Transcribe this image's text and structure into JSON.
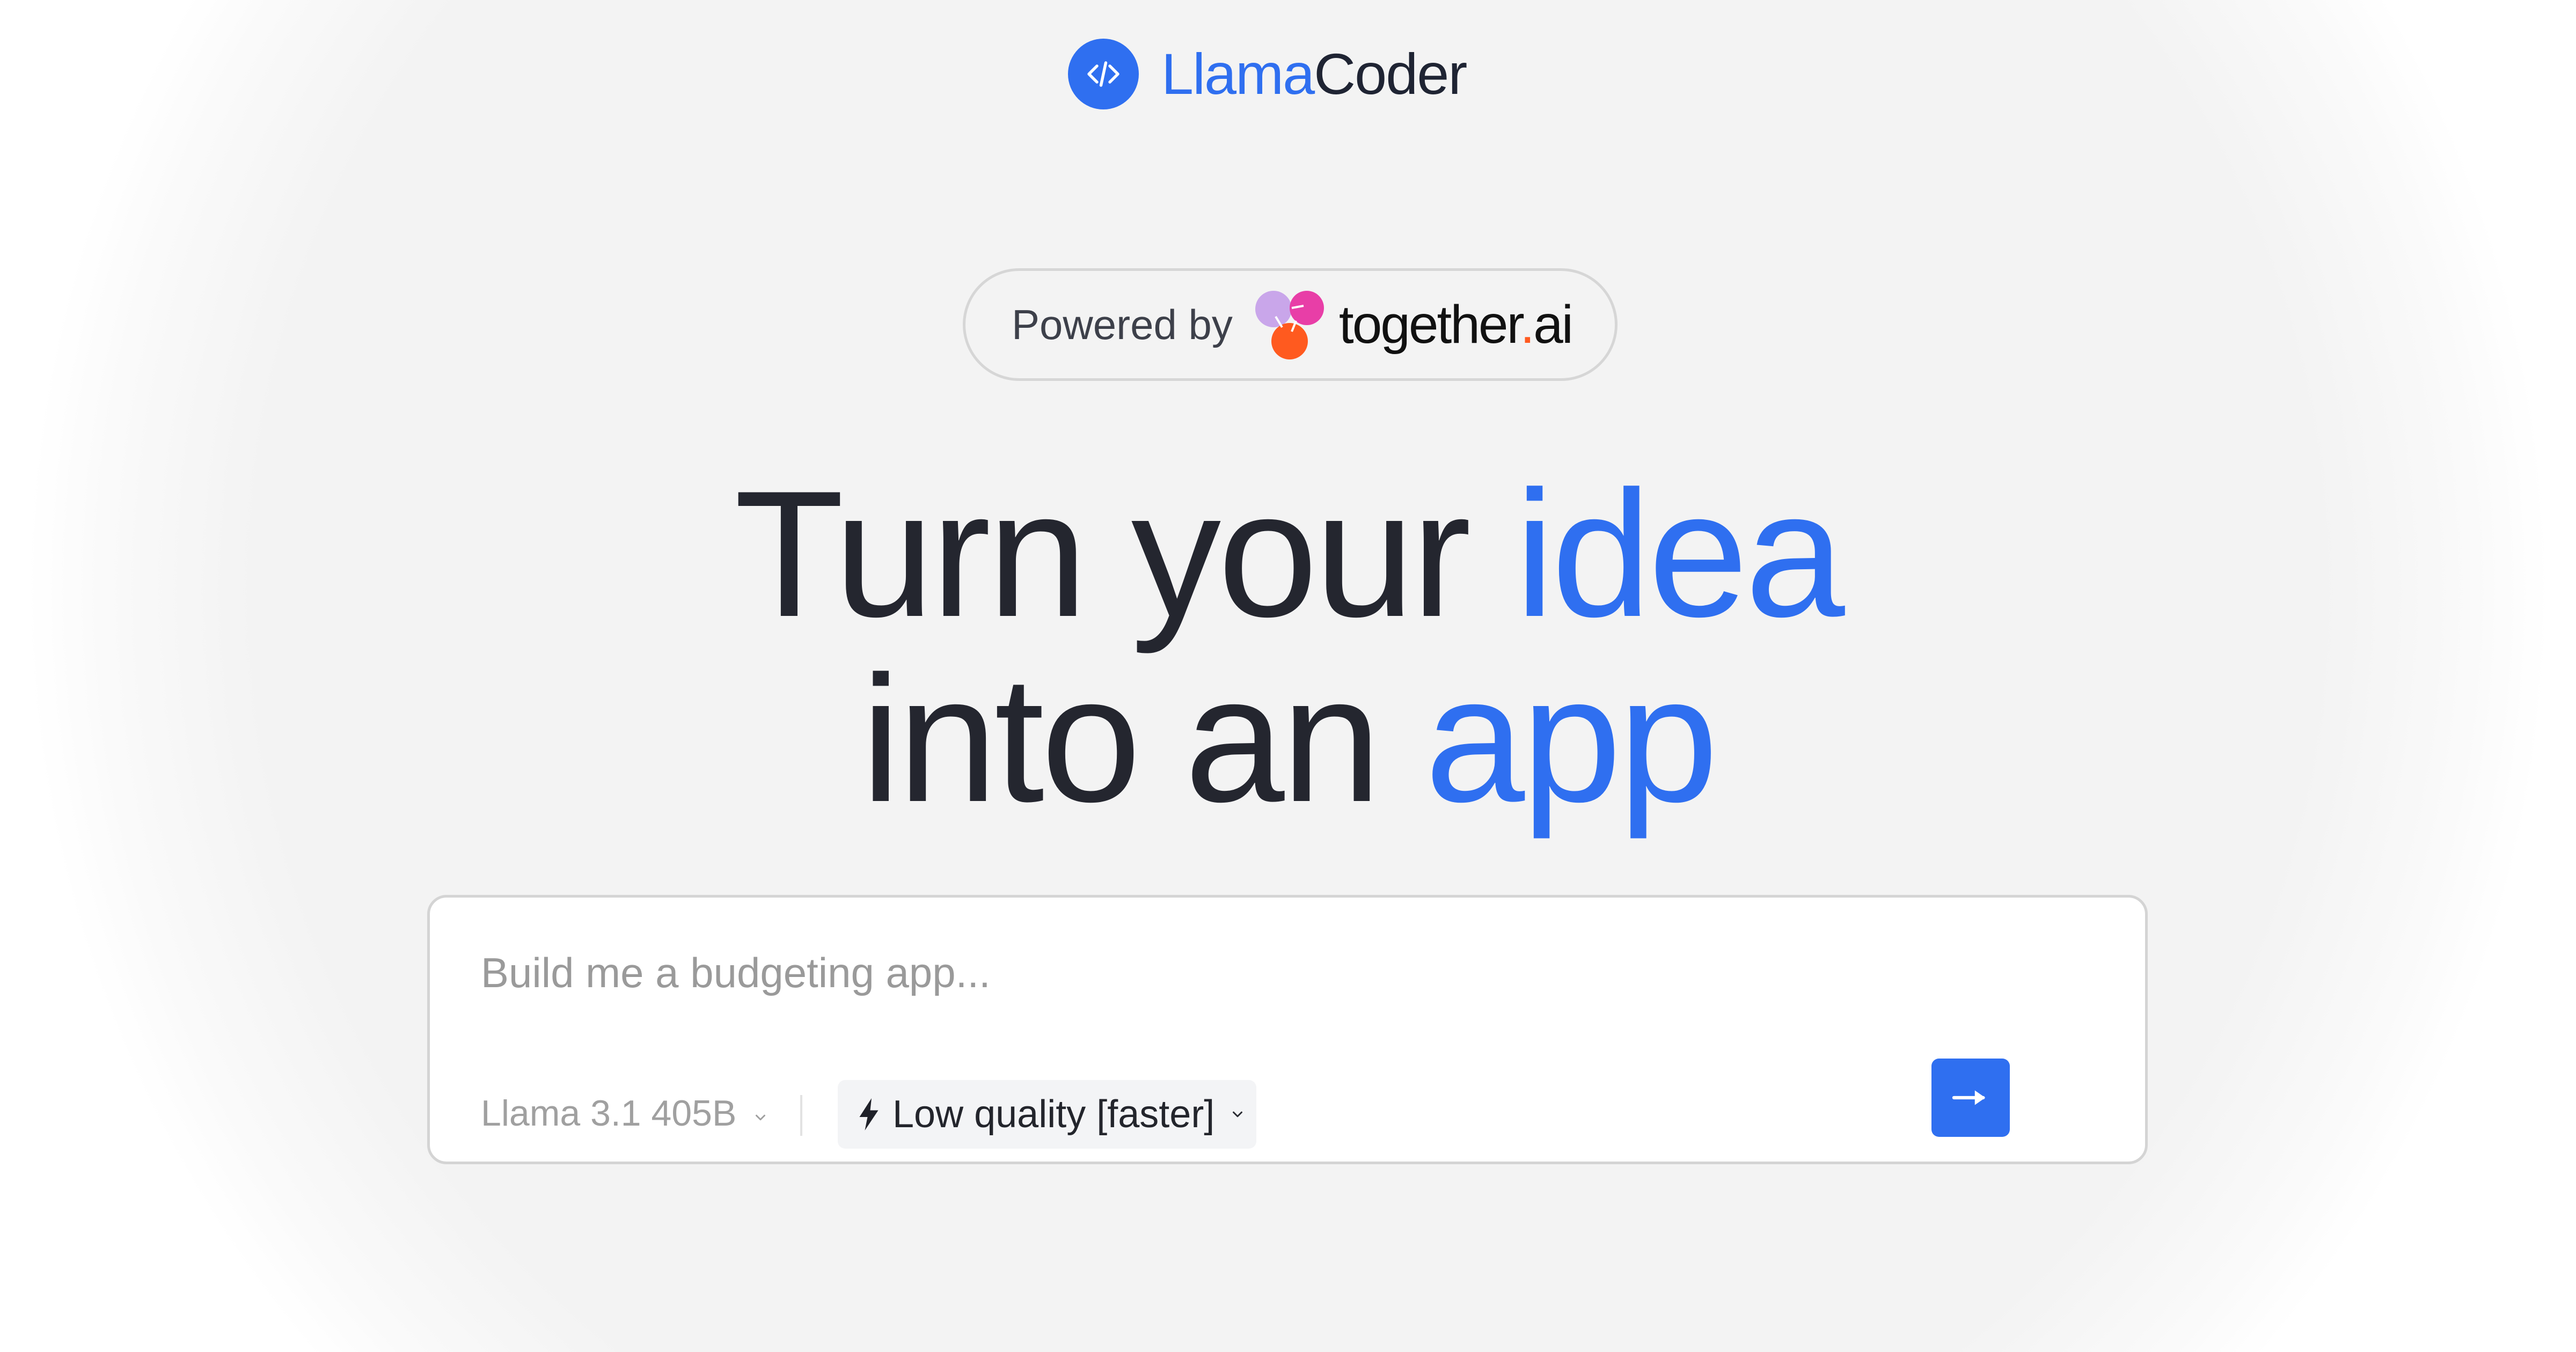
{
  "header": {
    "brand_part1": "Llama",
    "brand_part2": "Coder",
    "logo_icon": "code-brackets-icon"
  },
  "powered_by": {
    "label": "Powered by",
    "partner_name": "together",
    "partner_dot": ".",
    "partner_suffix": "ai"
  },
  "hero": {
    "line1_plain": "Turn your ",
    "line1_accent": "idea",
    "line2_plain": "into an ",
    "line2_accent": "app"
  },
  "prompt": {
    "placeholder": "Build me a budgeting app...",
    "value": "",
    "model_selected": "Llama 3.1 405B",
    "quality_selected": "Low quality [faster]",
    "submit_icon": "arrow-right-icon"
  },
  "colors": {
    "accent": "#2f6ff0",
    "text_dark": "#24262f",
    "together_orange": "#ff5a1f",
    "together_pink": "#e83ea7",
    "together_lilac": "#c9a6ea"
  }
}
